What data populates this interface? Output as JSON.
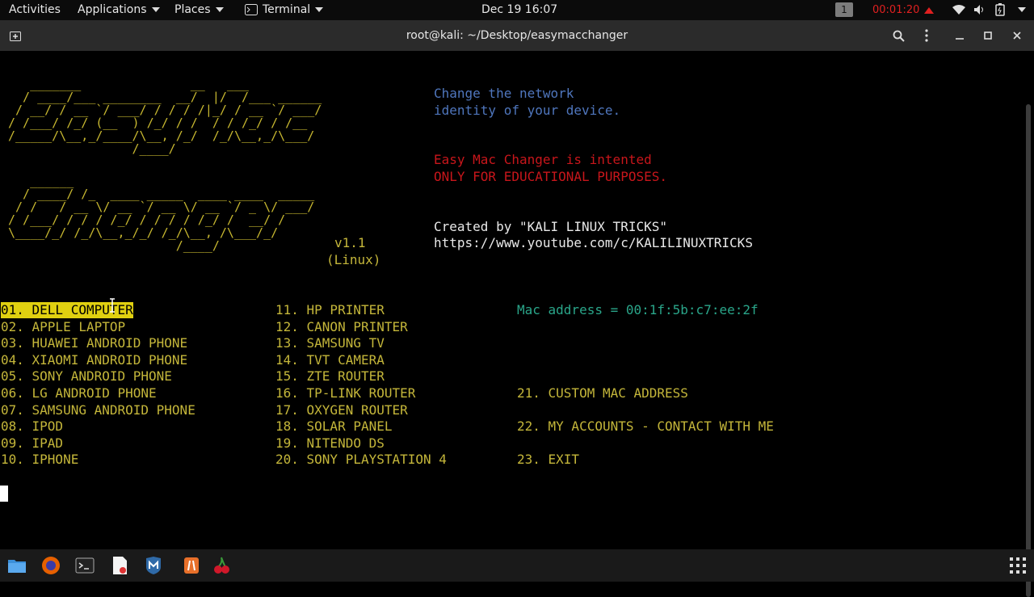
{
  "topbar": {
    "activities": "Activities",
    "applications": "Applications",
    "places": "Places",
    "terminal_menu": "Terminal",
    "clock": "Dec 19 16:07",
    "workspace": "1",
    "recording_time": "00:01:20"
  },
  "window": {
    "title": "root@kali: ~/Desktop/easymacchanger"
  },
  "banner": {
    "ascii_line1": "   _______               __   ___",
    "ascii_line2": "  / ____/___ ________  __/  |/  /___ ______",
    "ascii_line3": " / __/ / __ `/ ___/ / / / /|_/ / __ `/ ___/",
    "ascii_line4": "/ /___/ /_/ (__  ) /_/ / /  / / /_/ / /__",
    "ascii_line5": "/_____/\\__,_/____/\\__, /_/  /_/\\__,_/\\___/",
    "ascii_line6": "                 /____/",
    "ascii_line7": "   ______",
    "ascii_line8": "  / ____/ /_  ____ _____  ____ ____  _____",
    "ascii_line9": " / /   / __ \\/ __ `/ __ \\/ __ `/ _ \\/ ___/",
    "ascii_line10": "/ /___/ / / / /_/ / / / / /_/ /  __/ /",
    "ascii_line11": "\\____/_/ /_/\\__,_/_/ /_/\\__, /\\___/_/",
    "ascii_line12": "                       /____/",
    "version": "v1.1",
    "platform": "(Linux)",
    "tagline1": "Change the network",
    "tagline2": "identity of your device.",
    "warning1": "Easy Mac Changer is intented",
    "warning2": "ONLY FOR EDUCATIONAL PURPOSES.",
    "credit": "Created by \"KALI LINUX TRICKS\"",
    "url": "https://www.youtube.com/c/KALILINUXTRICKS"
  },
  "mac_address_line": "Mac address = 00:1f:5b:c7:ee:2f",
  "menu": {
    "col1": [
      "01. DELL COMPUTER",
      "02. APPLE LAPTOP",
      "03. HUAWEI ANDROID PHONE",
      "04. XIAOMI ANDROID PHONE",
      "05. SONY ANDROID PHONE",
      "06. LG ANDROID PHONE",
      "07. SAMSUNG ANDROID PHONE",
      "08. IPOD",
      "09. IPAD",
      "10. IPHONE"
    ],
    "col2": [
      "11. HP PRINTER",
      "12. CANON PRINTER",
      "13. SAMSUNG TV",
      "14. TVT CAMERA",
      "15. ZTE ROUTER",
      "16. TP-LINK ROUTER",
      "17. OXYGEN ROUTER",
      "18. SOLAR PANEL",
      "19. NITENDO DS",
      "20. SONY PLAYSTATION 4"
    ],
    "col3": [
      "21. CUSTOM MAC ADDRESS",
      "22. MY ACCOUNTS - CONTACT WITH ME",
      "23. EXIT"
    ]
  },
  "colors": {
    "ascii": "#c8b830",
    "tagline": "#4f76bd",
    "warning": "#c8161b",
    "menu": "#c4b63a",
    "mac": "#2aa68a",
    "highlight": "#e0d010"
  },
  "icons": {
    "dock": [
      "files-icon",
      "firefox-icon",
      "terminal-icon",
      "text-editor-icon",
      "metasploit-icon",
      "burpsuite-icon",
      "cherrytree-icon",
      "app-grid-icon"
    ]
  }
}
